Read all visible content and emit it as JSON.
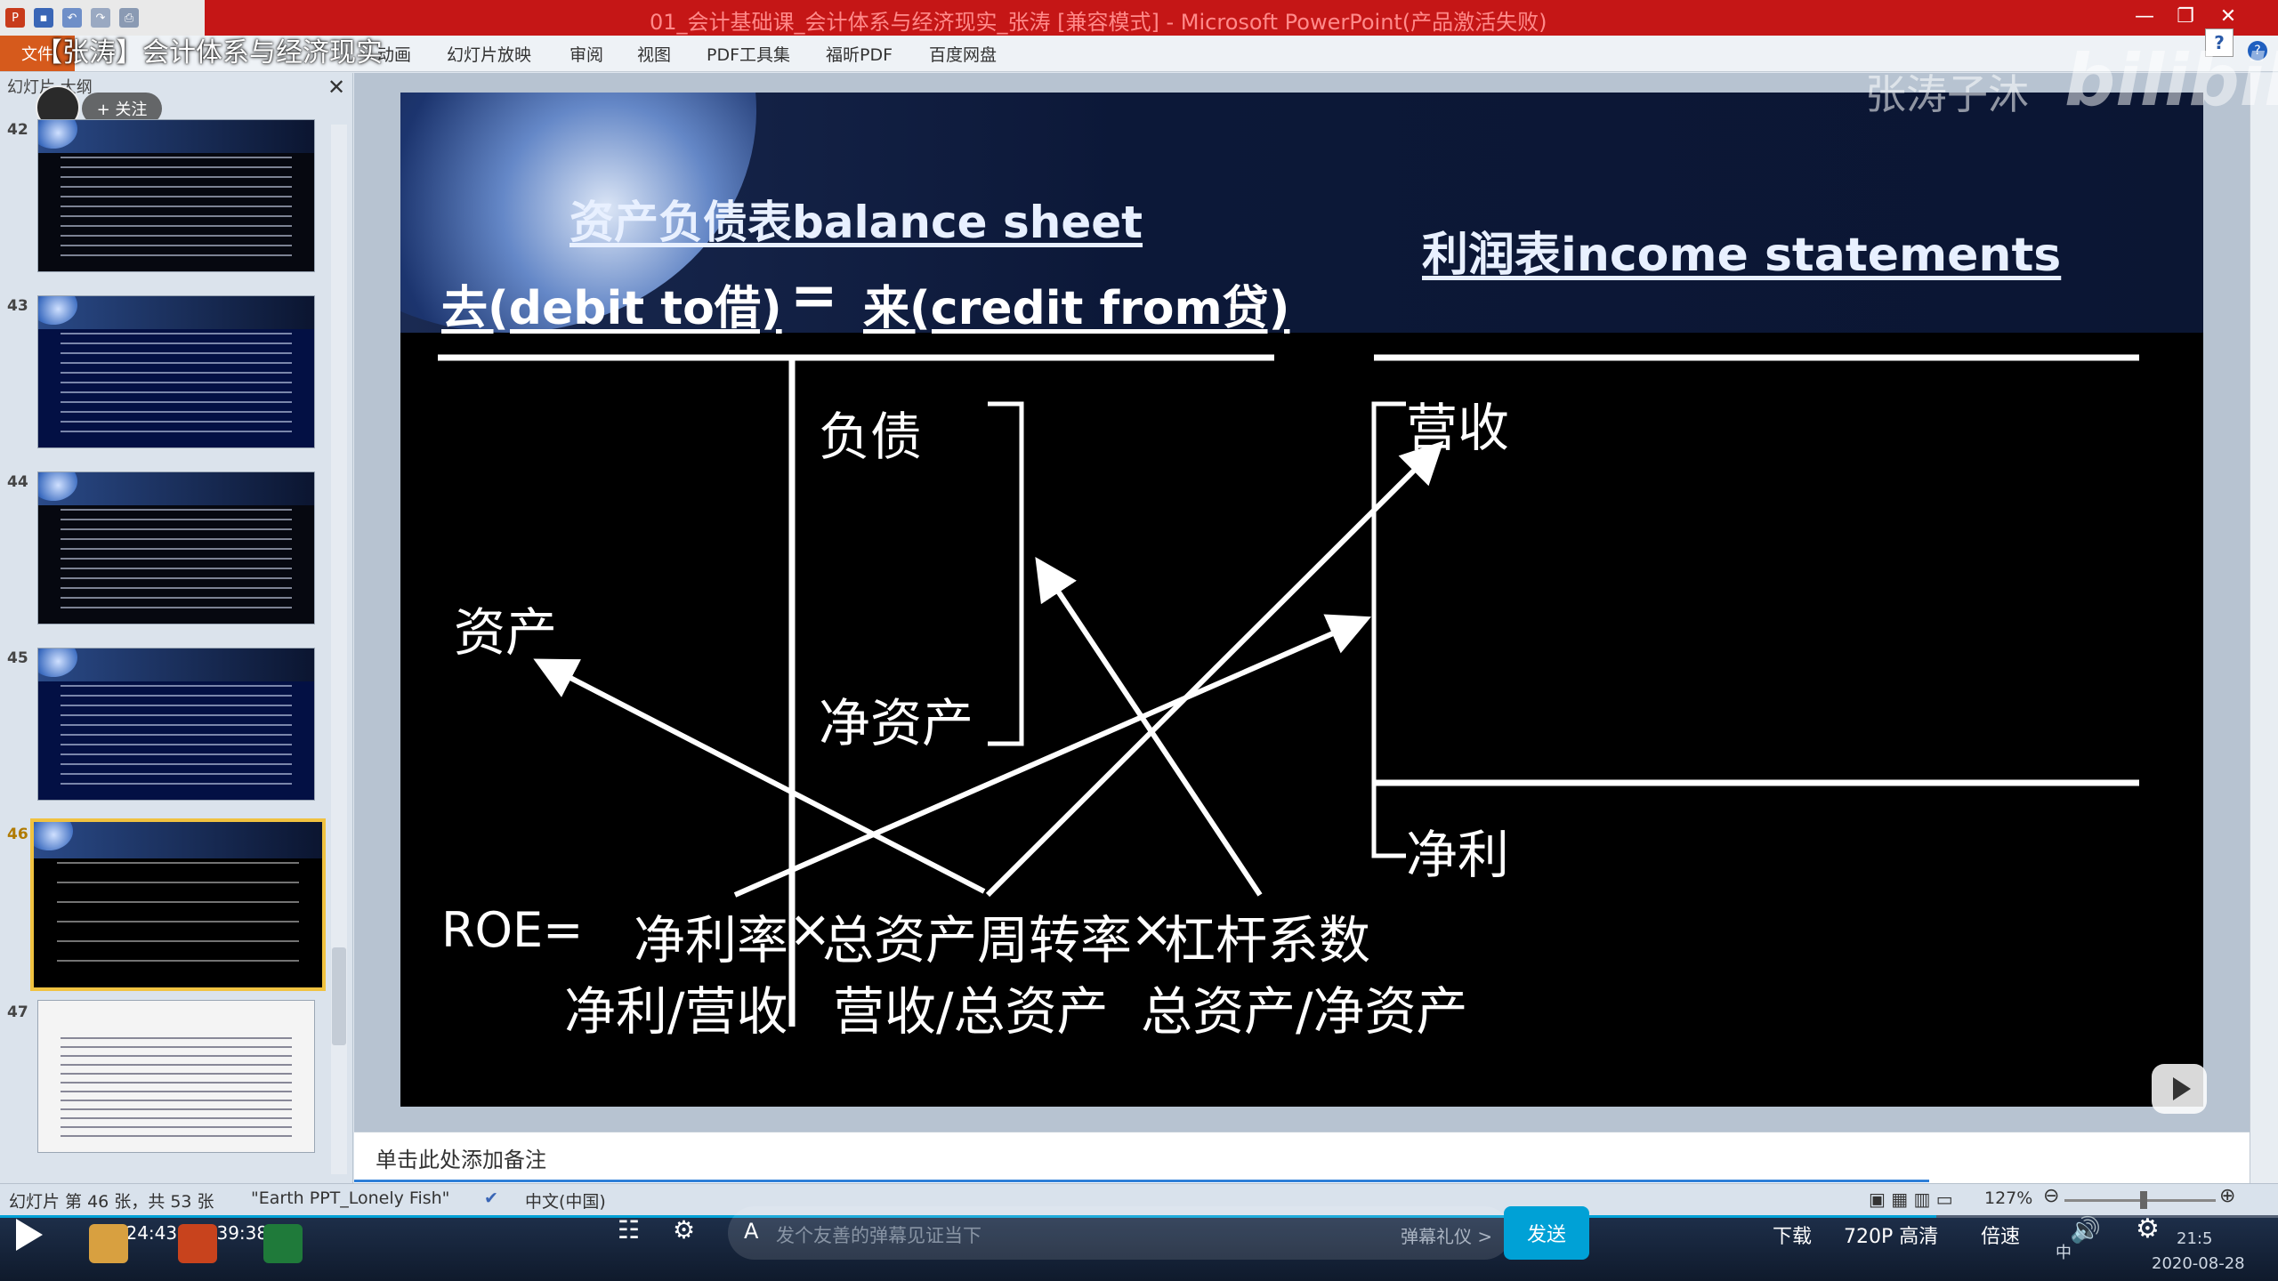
{
  "window": {
    "title": "01_会计基础课_会计体系与经济现实_张涛 [兼容模式] - Microsoft PowerPoint(产品激活失败)",
    "min": "—",
    "max": "❐",
    "close": "✕"
  },
  "video_title": "【张涛】会计体系与经济现实",
  "ribbon": {
    "file_tab": "文件",
    "tabs": [
      "动画",
      "幻灯片放映",
      "审阅",
      "视图",
      "PDF工具集",
      "福昕PDF",
      "百度网盘"
    ],
    "help": "?"
  },
  "slide_pane": {
    "tabs_label": "幻灯片  大纲",
    "close": "✕",
    "follow_label": "+ 关注",
    "slides": [
      {
        "num": "42",
        "selected": false
      },
      {
        "num": "43",
        "selected": false
      },
      {
        "num": "44",
        "selected": false
      },
      {
        "num": "45",
        "selected": false
      },
      {
        "num": "46",
        "selected": true
      },
      {
        "num": "47",
        "selected": false
      }
    ]
  },
  "slide": {
    "balance_title": "资产负债表balance sheet",
    "debit": "去(debit to借)",
    "equals": "=",
    "credit": "来(credit from贷)",
    "income_title": "利润表income statements",
    "liabilities": "负债",
    "equity": "净资产",
    "assets": "资产",
    "revenue": "营收",
    "net_income": "净利",
    "roe_label": "ROE=",
    "net_margin": "净利率",
    "times1": "×",
    "asset_turnover": "总资产周转率",
    "times2": "×",
    "leverage": "杠杆系数",
    "ratio1": "净利/营收",
    "ratio2": "营收/总资产",
    "ratio3": "总资产/净资产"
  },
  "watermark": {
    "name": "张涛子沐",
    "logo": "bilibili"
  },
  "notes": {
    "placeholder": "单击此处添加备注"
  },
  "statusbar": {
    "slide_info": "幻灯片 第 46 张，共 53 张",
    "theme": "\"Earth PPT_Lonely Fish\"",
    "language": "中文(中国)",
    "zoom": "127%"
  },
  "player": {
    "current_time": "1:24:43",
    "separator": "/",
    "total_time": "1:39:38",
    "progress": 0.85,
    "danmaku_placeholder": "发个友善的弹幕见证当下",
    "gift_label": "弹幕礼仪 >",
    "send_label": "发送",
    "download": "下载",
    "quality": "720P 高清",
    "speed": "倍速",
    "clock": "21:5",
    "date": "2020-08-28",
    "ime": "中"
  }
}
